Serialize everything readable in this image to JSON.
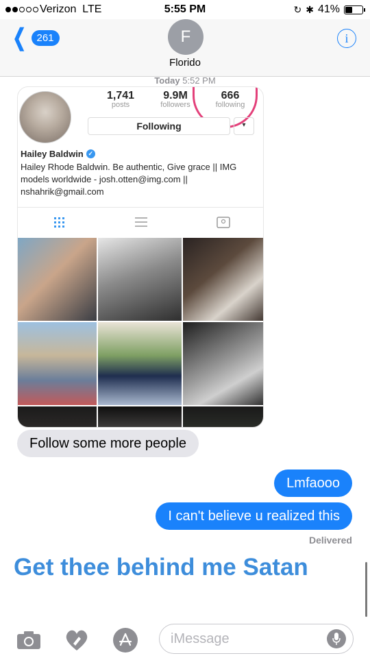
{
  "status_bar": {
    "carrier": "Verizon",
    "network": "LTE",
    "time": "5:55 PM",
    "battery": "41%",
    "battery_level": 0.41
  },
  "header": {
    "back_count": "261",
    "contact_initial": "F",
    "contact_name": "Florido",
    "info_label": "i"
  },
  "conversation": {
    "timestamp_day": "Today",
    "timestamp_time": "5:52 PM",
    "shared_image": {
      "stats": [
        {
          "num": "1,741",
          "label": "posts"
        },
        {
          "num": "9.9M",
          "label": "followers"
        },
        {
          "num": "666",
          "label": "following"
        }
      ],
      "follow_button": "Following",
      "dropdown": "▾",
      "profile_name": "Hailey Baldwin",
      "bio": "Hailey Rhode Baldwin. Be authentic, Give grace || IMG models worldwide - josh.otten@img.com || nshahrik@gmail.com"
    },
    "messages": [
      {
        "side": "received",
        "text": "Follow some more people"
      },
      {
        "side": "sent",
        "text": "Lmfaooo"
      },
      {
        "side": "sent",
        "text": "I can't believe u realized this"
      }
    ],
    "delivered_label": "Delivered",
    "big_text": "Get thee behind me Satan"
  },
  "input_bar": {
    "placeholder": "iMessage"
  },
  "colors": {
    "ios_blue": "#1a82fb",
    "bubble_gray": "#e5e5ea",
    "annotation_pink": "#e3407a",
    "big_text_blue": "#3d8ddb"
  }
}
